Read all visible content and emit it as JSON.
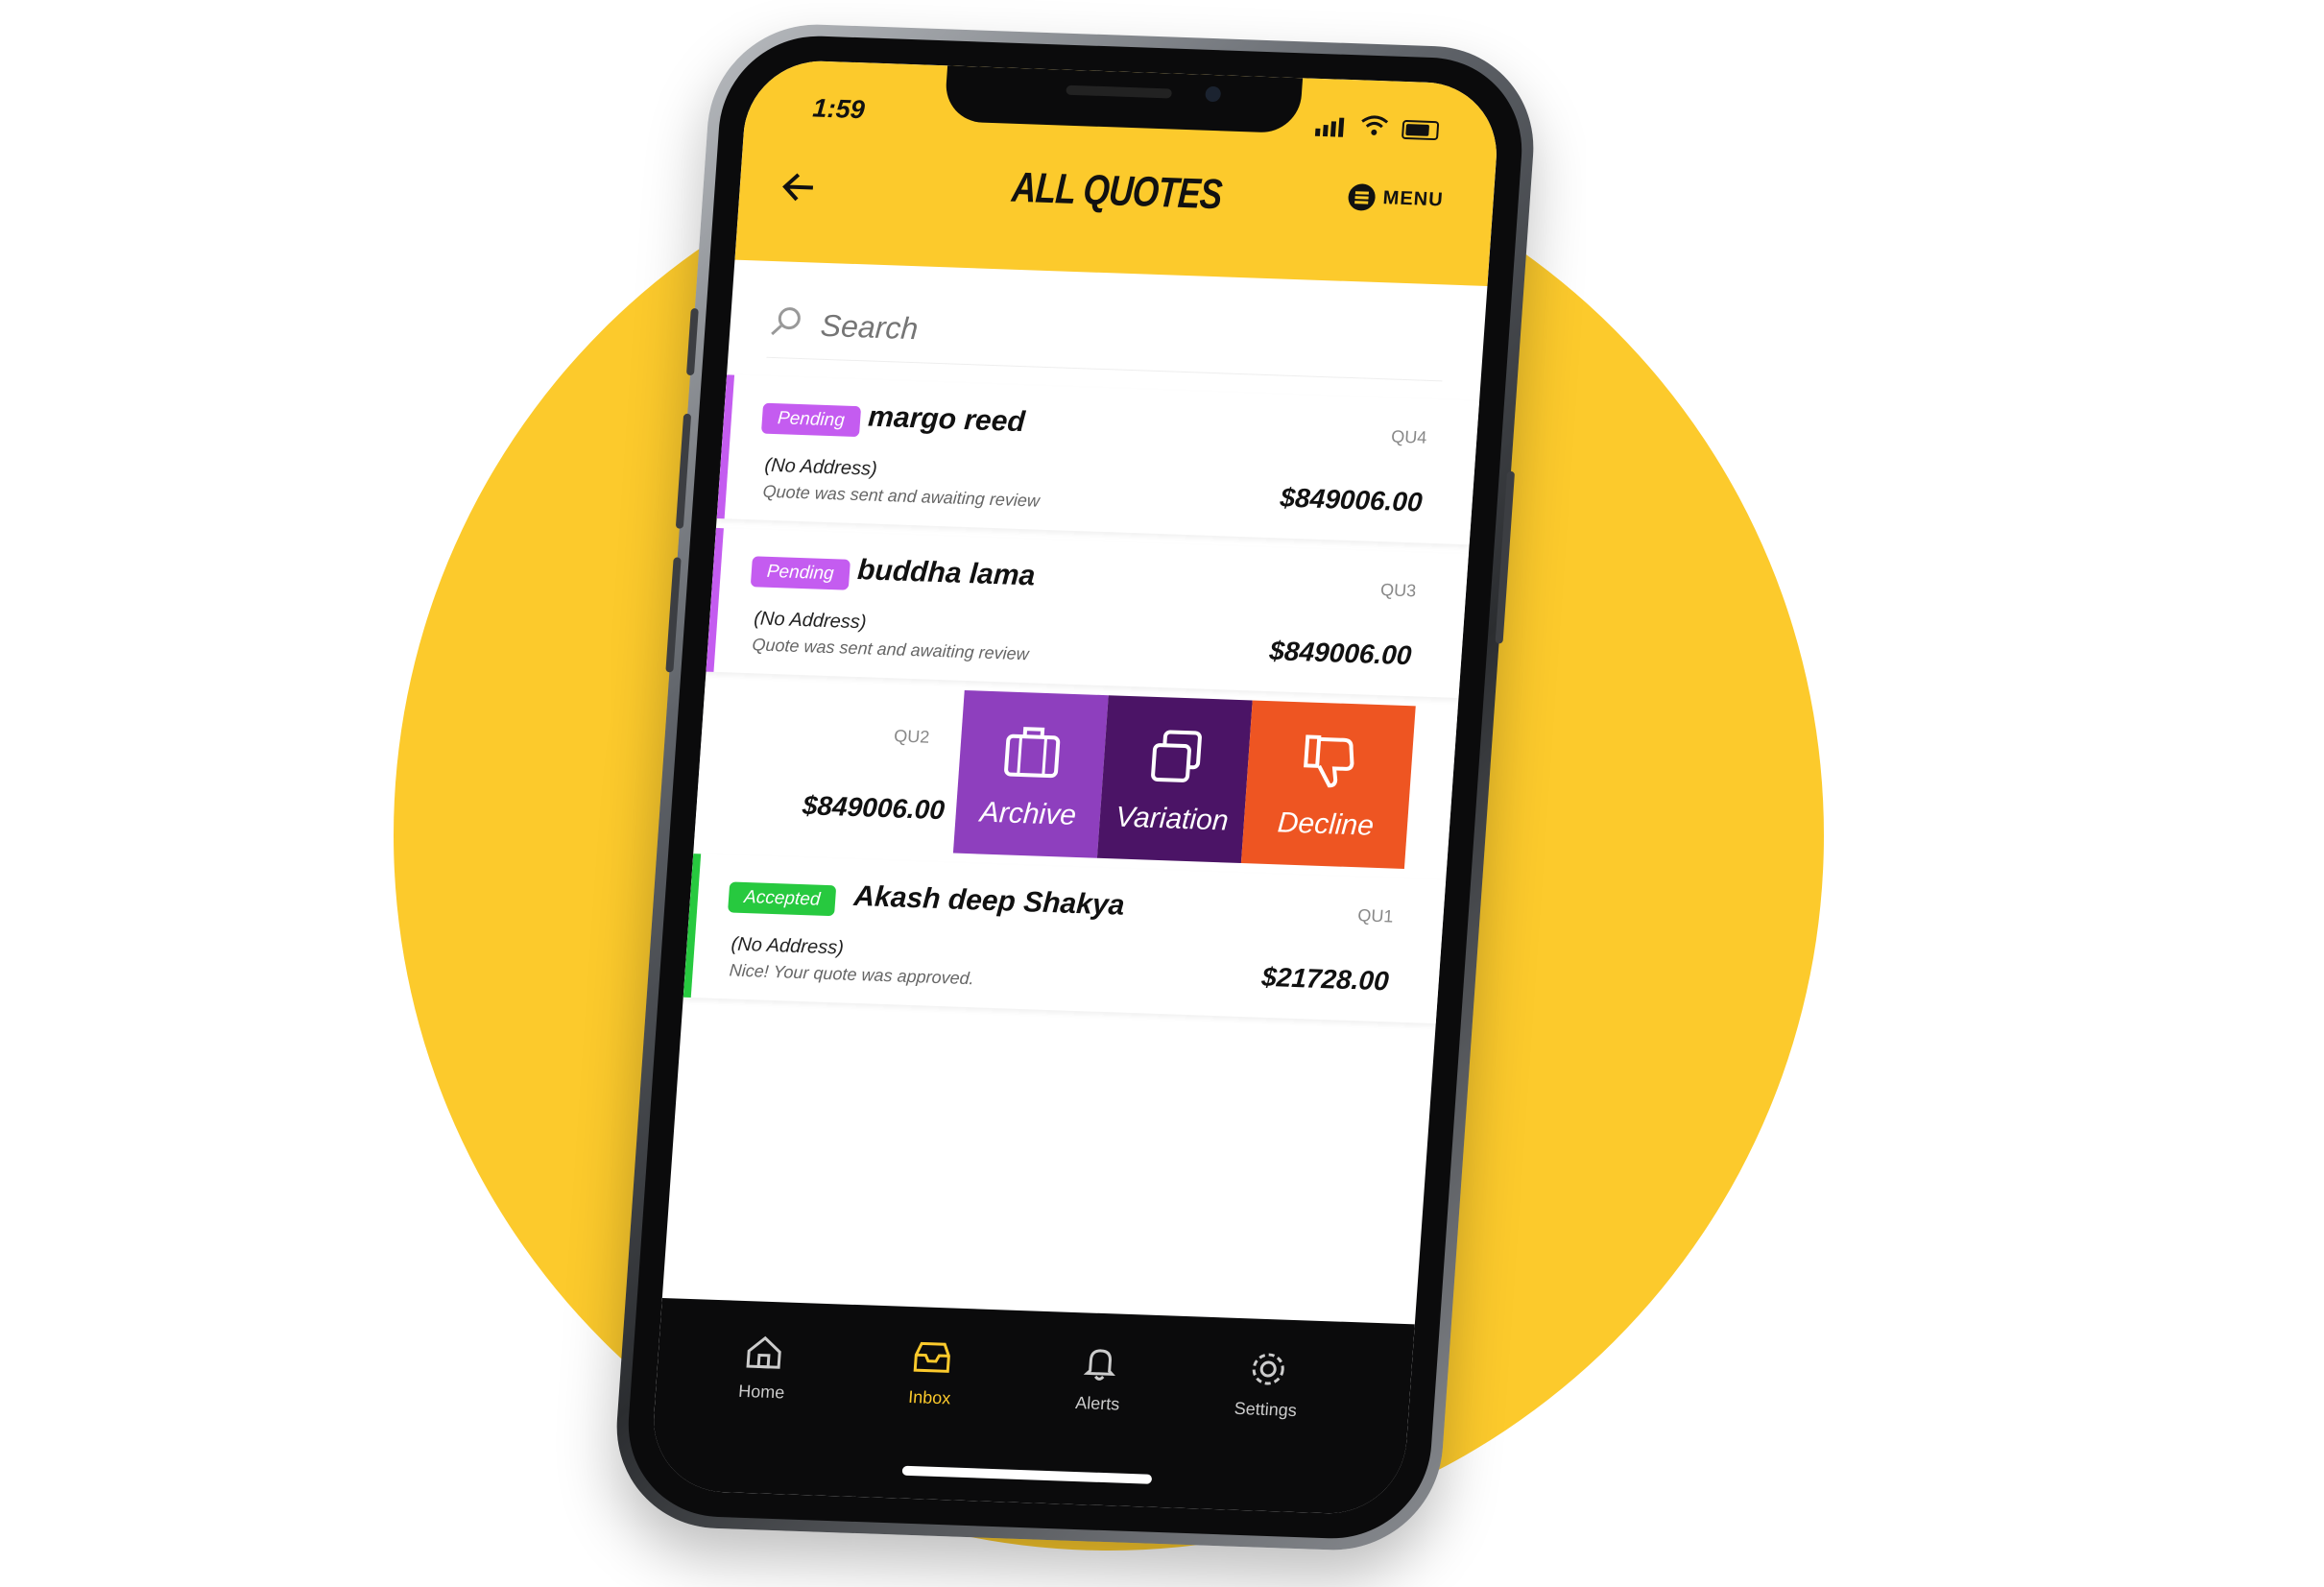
{
  "colors": {
    "brand_yellow": "#fcca2c",
    "pending": "#c45cf0",
    "accepted": "#27c93f",
    "archive": "#8e3fbe",
    "variation": "#4b1466",
    "decline": "#ee5522"
  },
  "status_bar": {
    "time": "1:59"
  },
  "header": {
    "back_icon": "arrow-left-icon",
    "title": "ALL QUOTES",
    "menu_label": "MENU",
    "menu_icon": "hamburger-circle-icon"
  },
  "search": {
    "placeholder": "Search",
    "icon": "search-icon"
  },
  "quotes": [
    {
      "status": "Pending",
      "name": "margo reed",
      "id": "QU4",
      "address": "(No Address)",
      "description": "Quote was sent and awaiting review",
      "amount": "$849006.00"
    },
    {
      "status": "Pending",
      "name": "buddha lama",
      "id": "QU3",
      "address": "(No Address)",
      "description": "Quote was sent and awaiting review",
      "amount": "$849006.00"
    },
    {
      "status": "",
      "name": "",
      "id": "QU2",
      "address": "",
      "description": "",
      "amount": "$849006.00"
    },
    {
      "status": "Accepted",
      "name": "Akash deep Shakya",
      "id": "QU1",
      "address": "(No Address)",
      "description": "Nice! Your quote was approved.",
      "amount": "$21728.00"
    }
  ],
  "swipe_actions": [
    {
      "label": "Archive",
      "icon": "briefcase-icon"
    },
    {
      "label": "Variation",
      "icon": "copy-icon"
    },
    {
      "label": "Decline",
      "icon": "thumbs-down-icon"
    }
  ],
  "tabs": [
    {
      "label": "Home",
      "icon": "home-icon",
      "active": false
    },
    {
      "label": "Inbox",
      "icon": "inbox-icon",
      "active": true
    },
    {
      "label": "Alerts",
      "icon": "bell-icon",
      "active": false
    },
    {
      "label": "Settings",
      "icon": "gear-icon",
      "active": false
    }
  ]
}
